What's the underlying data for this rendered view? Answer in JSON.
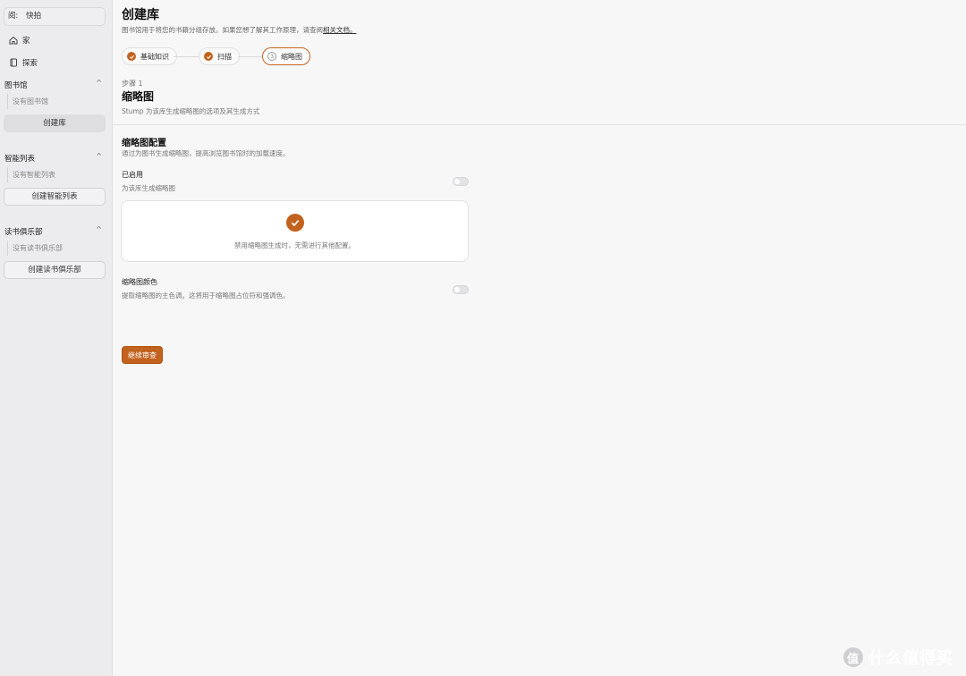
{
  "sidebar": {
    "top_prefix": "阅:",
    "top_bookname": "快拍",
    "nav": [
      {
        "label": "家",
        "icon": "home-icon"
      },
      {
        "label": "探索",
        "icon": "book-icon"
      }
    ],
    "sections": {
      "library": {
        "title": "图书馆",
        "empty": "没有图书馆",
        "button": "创建库"
      },
      "smartlist": {
        "title": "智能列表",
        "empty": "没有智能列表",
        "button": "创建智能列表"
      },
      "bookclub": {
        "title": "读书俱乐部",
        "empty": "没有读书俱乐部",
        "button": "创建读书俱乐部"
      }
    }
  },
  "main": {
    "title": "创建库",
    "subtitle": "图书馆用于将您的书籍分组存放。如果您想了解其工作原理，请查阅",
    "subtitle_link": "相关文档。",
    "steps": [
      {
        "label": "基础知识",
        "state": "done"
      },
      {
        "label": "扫描",
        "state": "done"
      },
      {
        "label": "缩略图",
        "state": "current",
        "number": "3"
      }
    ],
    "step_label": "步骤 1",
    "step_title": "缩略图",
    "step_desc": "Stump 为该库生成缩略图的选项及其生成方式",
    "section_title": "缩略图配置",
    "section_desc": "通过为图书生成缩略图，提高浏览图书馆时的加载速度。",
    "options": {
      "enabled": {
        "label": "已启用",
        "desc": "为该库生成缩略图",
        "on": false
      },
      "color": {
        "label": "缩略图颜色",
        "desc": "提取缩略图的主色调。这将用于缩略图占位符和强调色。",
        "on": false
      }
    },
    "info_text": "禁用缩略图生成时，无需进行其他配置。",
    "continue_button": "继续审查"
  },
  "watermark": {
    "logo": "值",
    "text": "什么值得买"
  },
  "colors": {
    "accent": "#c2621f",
    "sidebar_bg": "#ececee",
    "page_bg": "#f7f7f8"
  }
}
